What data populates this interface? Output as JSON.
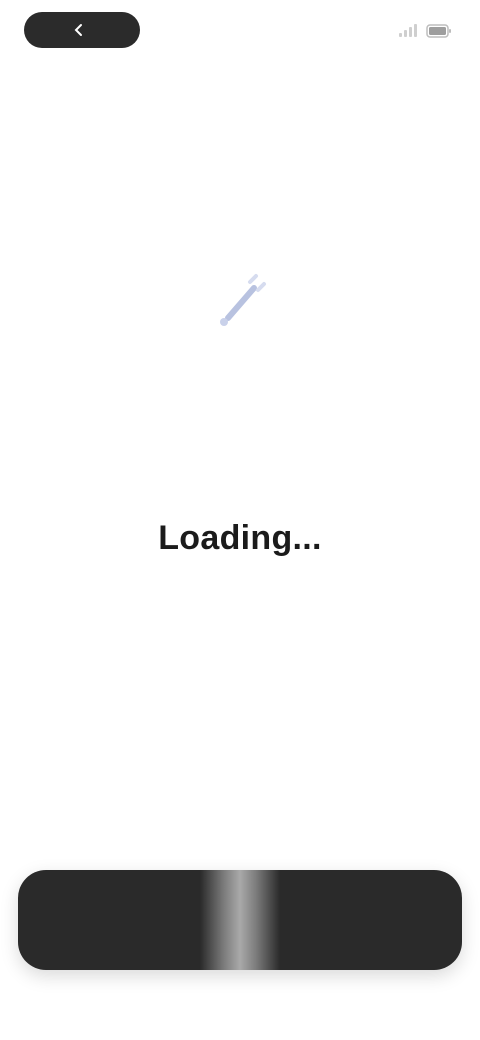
{
  "header": {
    "back_label": "",
    "back_icon": "chevron-left-icon",
    "right_icons": [
      "signal-icon",
      "battery-icon"
    ]
  },
  "hero": {
    "icon": "sparkle-icon",
    "accent_color": "#b8c2e0"
  },
  "content": {
    "title": "Loading...",
    "subtitle_lines": [
      "",
      ""
    ]
  },
  "bottom_bar": {
    "left_label": "",
    "right_label": "",
    "background": "#2a2a2a"
  }
}
